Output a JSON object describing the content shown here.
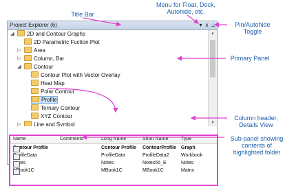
{
  "callouts": {
    "title_bar": "Title Bar",
    "menu": [
      "Menu for Float, Dock,",
      "Autohide, etc."
    ],
    "pin": [
      "Pin/Autohide",
      "Toggle"
    ],
    "primary_panel": "Primary Panel",
    "column_header": [
      "Column header,",
      "Details View"
    ],
    "sub_panel": [
      "Sub-panel showing",
      "contents of",
      "highlighted folder"
    ]
  },
  "panel": {
    "title": "Project Explorer (6)",
    "menu_glyph": "▾",
    "close_glyph": "x",
    "pin_glyph": "⊥"
  },
  "tree": [
    {
      "label": "2D and Contour Graphs",
      "expander": "◢",
      "level": 0
    },
    {
      "label": "2D Parametric Fuction Plot",
      "expander": "",
      "level": 1
    },
    {
      "label": "Area",
      "expander": "▷",
      "level": 1
    },
    {
      "label": "Column, Bar",
      "expander": "▷",
      "level": 1
    },
    {
      "label": "Contour",
      "expander": "◢",
      "level": 1
    },
    {
      "label": "Contour Plot with Vector Overlay",
      "expander": "",
      "level": 2
    },
    {
      "label": "Heat Map",
      "expander": "",
      "level": 2
    },
    {
      "label": "Polar Contour",
      "expander": "",
      "level": 2
    },
    {
      "label": "Profile",
      "expander": "",
      "level": 2,
      "selected": true
    },
    {
      "label": "Ternary Contour",
      "expander": "",
      "level": 2
    },
    {
      "label": "XYZ Contour",
      "expander": "",
      "level": 2
    },
    {
      "label": "Line and Symbol",
      "expander": "▷",
      "level": 1
    }
  ],
  "details": {
    "columns": [
      "Name",
      "Comments",
      "Long Name",
      "Short Name",
      "Type"
    ],
    "rows": [
      {
        "name": "Contour Profile",
        "comments": "",
        "long_name": "Contour Profile",
        "short_name": "ContourProfile",
        "type": "Graph",
        "bold": true
      },
      {
        "name": "ProfileData",
        "comments": "",
        "long_name": "ProfileData",
        "short_name": "ProfileData2",
        "type": "Workbook",
        "bold": false
      },
      {
        "name": "Notes",
        "comments": "",
        "long_name": "Notes",
        "short_name": "Notes55_E",
        "type": "Notes",
        "bold": false
      },
      {
        "name": "MBook1C",
        "comments": "",
        "long_name": "MBook1C",
        "short_name": "MBook1C",
        "type": "Matrix",
        "bold": false
      }
    ]
  },
  "colors": {
    "callout_text": "#1f5fa8",
    "arrow": "#e040d0",
    "selection": "#cde3f7"
  }
}
